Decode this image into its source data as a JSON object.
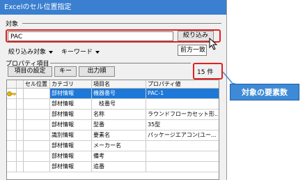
{
  "window": {
    "title": "Excelのセル位置指定"
  },
  "target": {
    "group_label": "対象",
    "search_value": "PAC",
    "filter_button": "絞り込み",
    "filter_target": "絞り込み対象",
    "keyword": "キーワード",
    "match_mode": "前方一致"
  },
  "property": {
    "group_label": "プロパティ項目",
    "buttons": [
      "項目の設定",
      "キー",
      "出力順"
    ],
    "count_text": "15 件"
  },
  "table": {
    "headers": [
      "",
      "",
      "セル位置",
      "カテゴリ",
      "項目名",
      "プロパティ値"
    ],
    "rows": [
      {
        "category": "部材情報",
        "name": "機器番号",
        "value": "PAC-1",
        "key": true,
        "selected": true
      },
      {
        "category": "部材情報",
        "name": "　枝番号",
        "value": "",
        "key": false,
        "selected": false
      },
      {
        "category": "部材情報",
        "name": "名称",
        "value": "ラウンドフローカセット形...",
        "key": false,
        "selected": false
      },
      {
        "category": "部材情報",
        "name": "型番",
        "value": "35型",
        "key": false,
        "selected": false
      },
      {
        "category": "識別情報",
        "name": "要素名",
        "value": "パッケージエアコン(ユー...",
        "key": false,
        "selected": false
      },
      {
        "category": "部材情報",
        "name": "メーカー名",
        "value": "",
        "key": false,
        "selected": false
      },
      {
        "category": "部材情報",
        "name": "備考",
        "value": "",
        "key": false,
        "selected": false
      },
      {
        "category": "部材情報",
        "name": "追番",
        "value": "",
        "key": false,
        "selected": false
      }
    ]
  },
  "annotation": {
    "text": "対象の要素数"
  },
  "colors": {
    "highlight": "#e0201e",
    "selection": "#1e78d7",
    "callout": "#3f8ad6",
    "titlebar": "#3a7fd0"
  },
  "icons": [
    "key-icon",
    "mouse-cursor-icon",
    "chevron-down-icon"
  ]
}
